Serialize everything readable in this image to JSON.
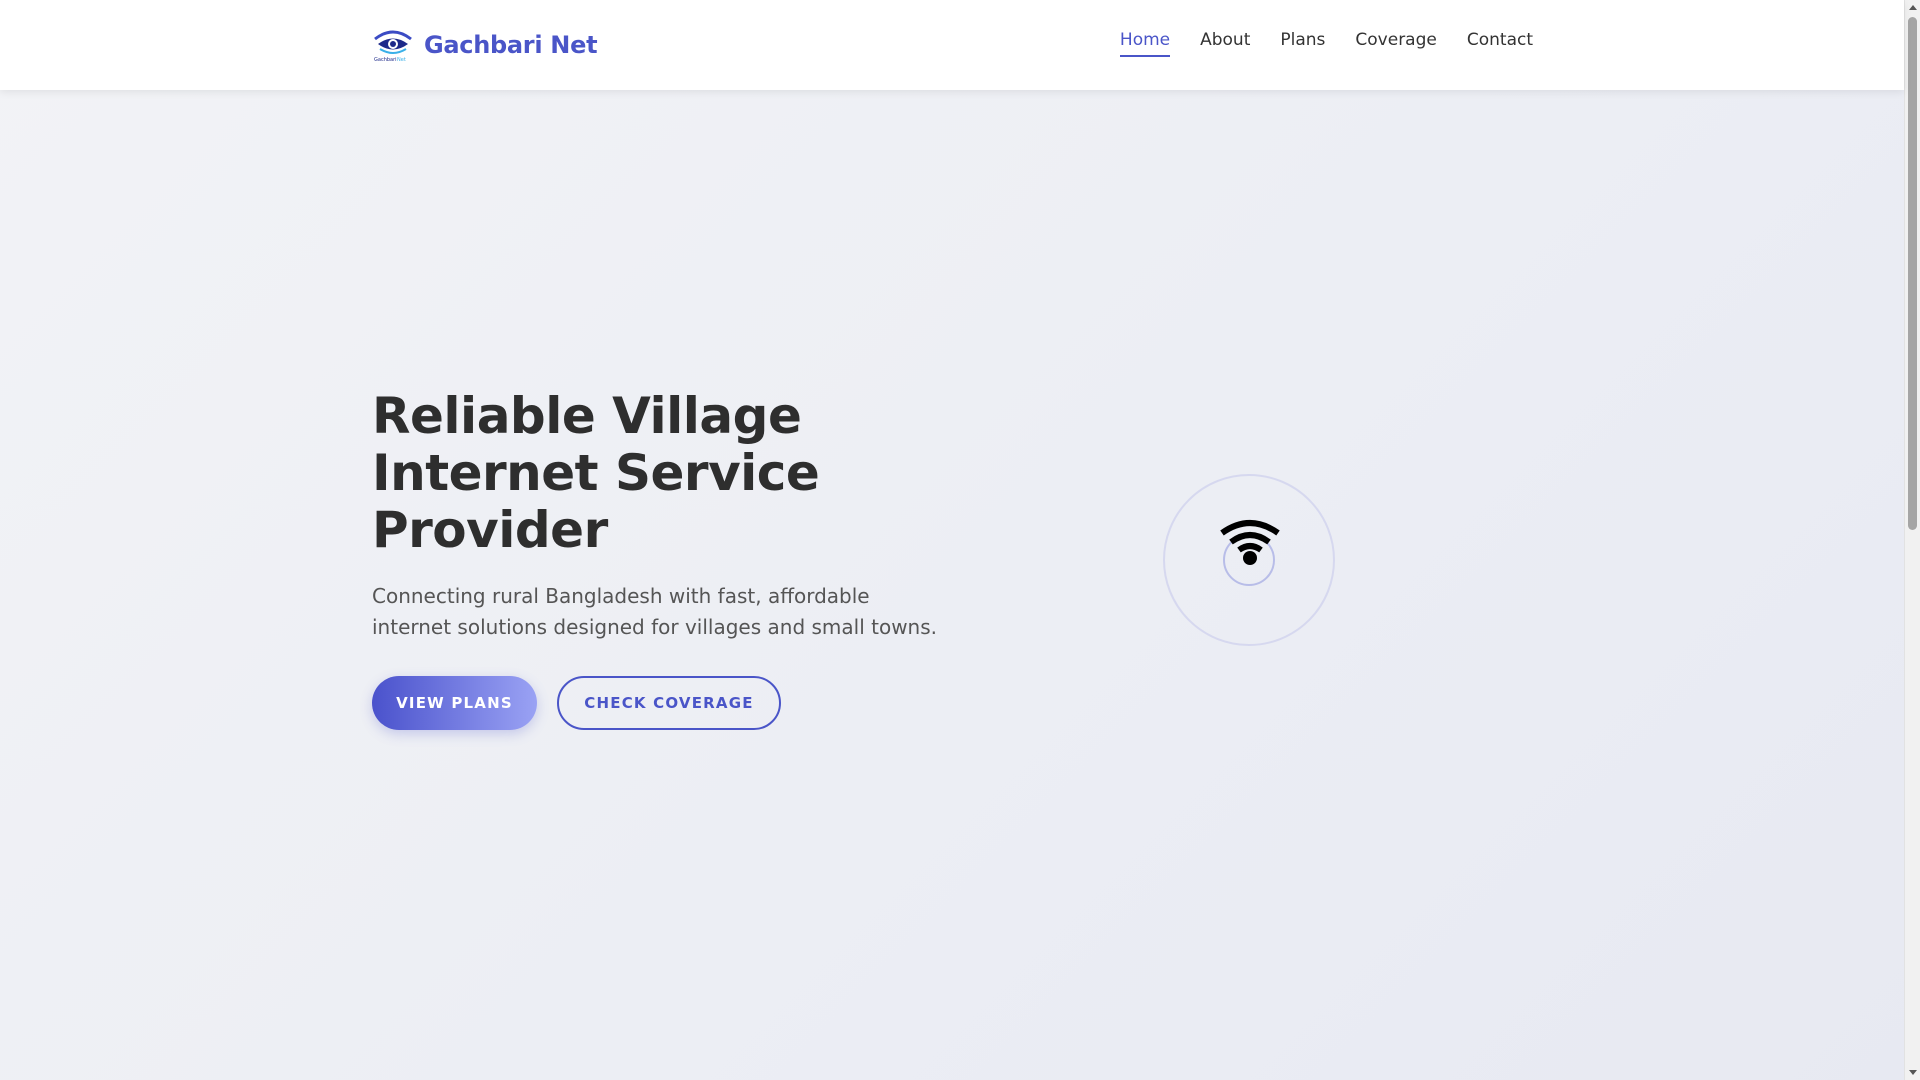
{
  "brand": {
    "name": "Gachbari Net",
    "logo_icon": "eye-wifi-logo-icon",
    "logo_caption": "Gachbari Net",
    "color": "#4a55c8"
  },
  "nav": {
    "items": [
      {
        "label": "Home",
        "active": true
      },
      {
        "label": "About",
        "active": false
      },
      {
        "label": "Plans",
        "active": false
      },
      {
        "label": "Coverage",
        "active": false
      },
      {
        "label": "Contact",
        "active": false
      }
    ]
  },
  "hero": {
    "title": "Reliable Village Internet Service Provider",
    "subtitle": "Connecting rural Bangladesh with fast, affordable internet solutions designed for villages and small towns.",
    "primary_button": "VIEW PLANS",
    "secondary_button": "CHECK COVERAGE",
    "graphic_icon": "wifi-icon"
  },
  "colors": {
    "accent": "#4a55c8",
    "button_gradient_start": "#4a52cc",
    "button_gradient_end": "#9aa2f4",
    "title": "#2e2e2e",
    "text": "#555555"
  }
}
